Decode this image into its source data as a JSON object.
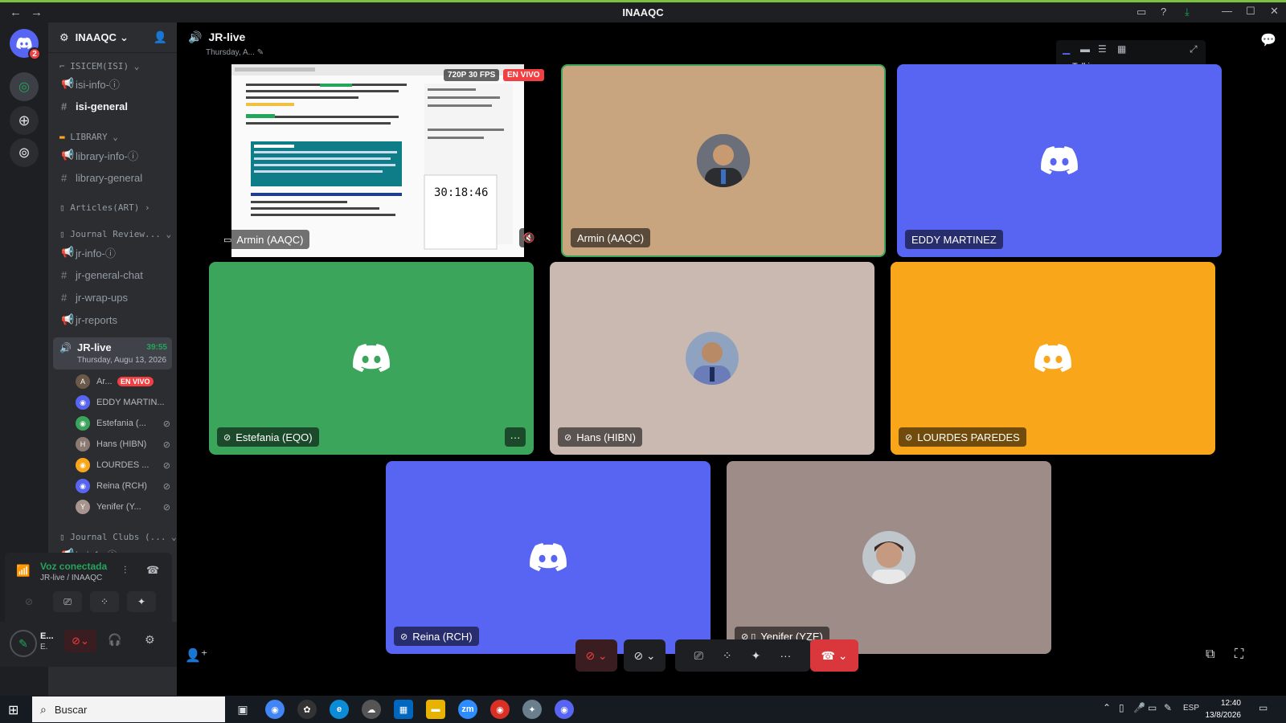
{
  "window": {
    "title": "INAAQC"
  },
  "server": {
    "name": "INAAQC",
    "badge": "2"
  },
  "sidebar": {
    "categories": [
      {
        "label": "⌐ ISICEM(ISI) ⌄"
      },
      {
        "label": "LIBRARY ⌄"
      },
      {
        "label": "Articles(ART) ›"
      },
      {
        "label": "Journal Review... ⌄"
      },
      {
        "label": "Journal Clubs (... ⌄"
      }
    ],
    "channels": [
      {
        "label": "isi-info-ⓘ"
      },
      {
        "label": "isi-general"
      },
      {
        "label": "library-info-ⓘ"
      },
      {
        "label": "library-general"
      },
      {
        "label": "jr-info-ⓘ"
      },
      {
        "label": "jr-general-chat"
      },
      {
        "label": "jr-wrap-ups"
      },
      {
        "label": "jr-reports"
      },
      {
        "label": "jc-info-ⓘ"
      }
    ],
    "live_channel": {
      "name": "JR-live",
      "duration": "39:55",
      "date": "Thursday, Augu 13, 2026"
    },
    "members": [
      {
        "name": "Ar...",
        "badge": "EN VIVO"
      },
      {
        "name": "EDDY MARTIN..."
      },
      {
        "name": "Estefania (..."
      },
      {
        "name": "Hans (HIBN)"
      },
      {
        "name": "LOURDES ..."
      },
      {
        "name": "Reina (RCH)"
      },
      {
        "name": "Yenifer (Y..."
      }
    ]
  },
  "voice": {
    "status": "Voz conectada",
    "location": "JR-live / INAAQC"
  },
  "user": {
    "name": "E...",
    "tag": "E."
  },
  "main": {
    "channel_title": "JR-live",
    "channel_date": "Thursday, A...",
    "talking_label": "Talking:",
    "stream": {
      "resolution": "720P 30 FPS",
      "live": "EN VIVO",
      "timer": "30:18:46",
      "name": "Armin (AAQC)"
    },
    "tiles": [
      {
        "name": "Armin (AAQC)",
        "color": "#c8a57f"
      },
      {
        "name": "EDDY MARTINEZ",
        "color": "#5865f2"
      },
      {
        "name": "Estefania (EQO)",
        "color": "#3ba55c"
      },
      {
        "name": "Hans (HIBN)",
        "color": "#c9b9b1"
      },
      {
        "name": "LOURDES PAREDES",
        "color": "#faa61a"
      },
      {
        "name": "Reina (RCH)",
        "color": "#5865f2"
      },
      {
        "name": "Yenifer (YZE)",
        "color": "#9e8c88"
      }
    ]
  },
  "taskbar": {
    "search_placeholder": "Buscar",
    "lang": "ESP",
    "time": "12:40",
    "date": "13/8/2026"
  }
}
